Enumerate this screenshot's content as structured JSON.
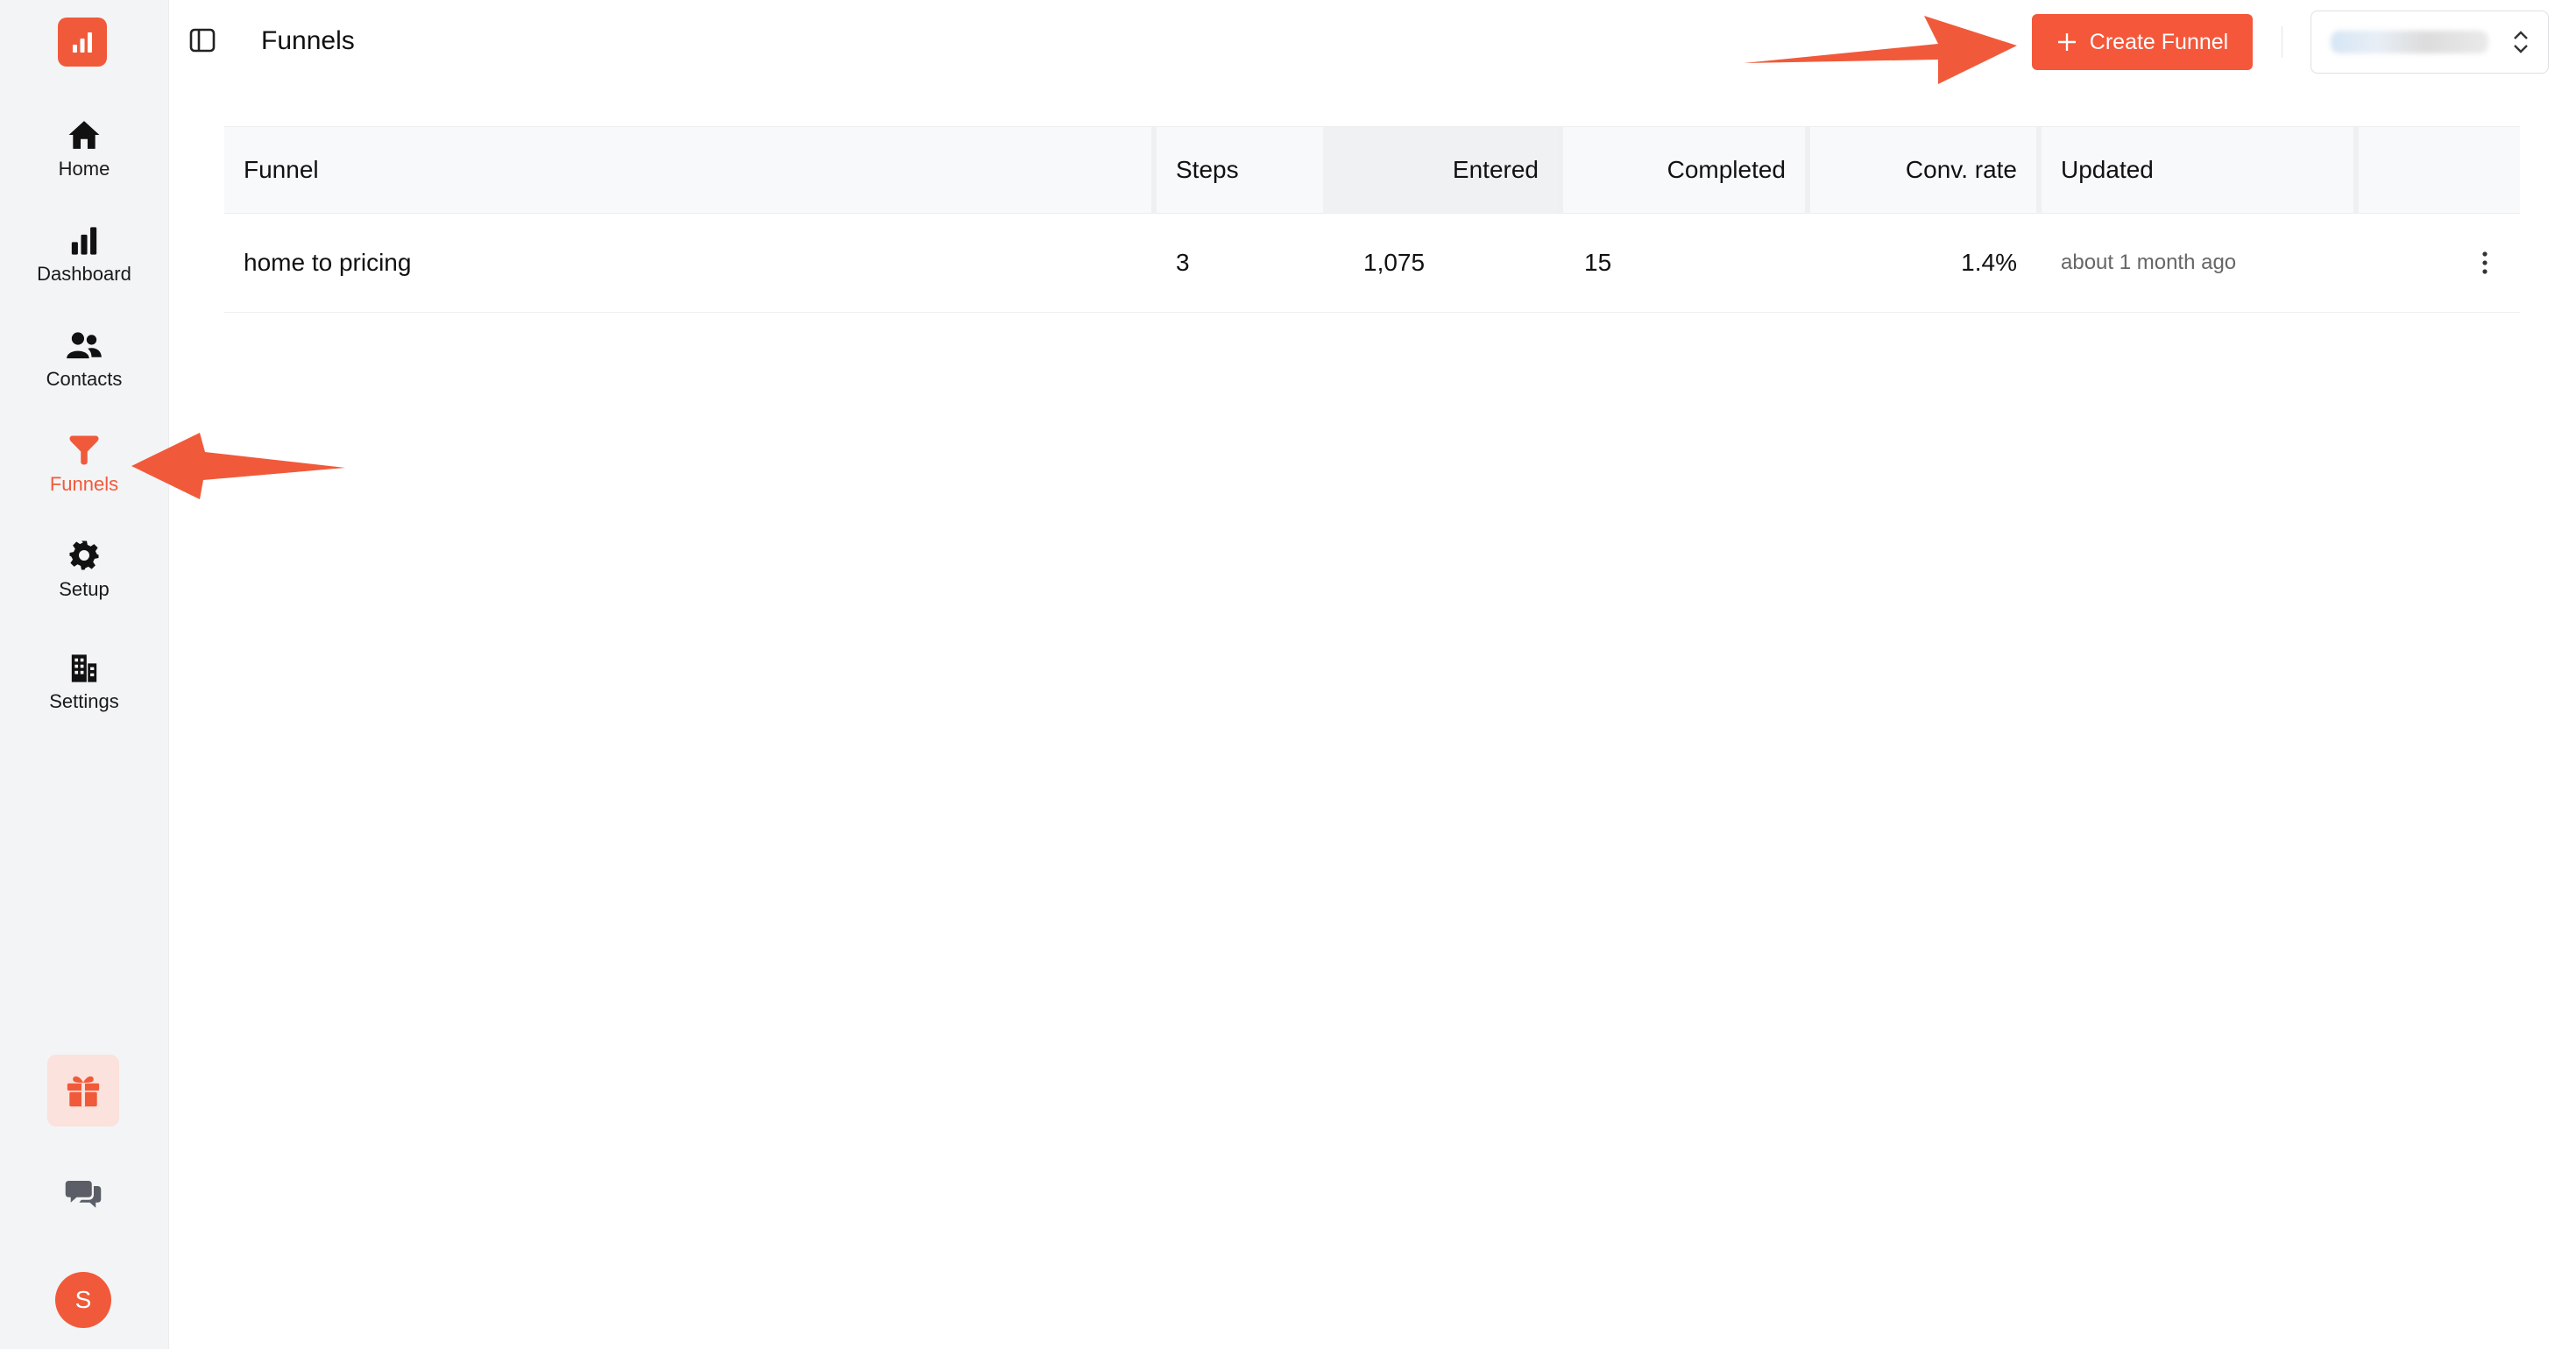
{
  "sidebar": {
    "items": [
      {
        "label": "Home",
        "icon": "home-icon"
      },
      {
        "label": "Dashboard",
        "icon": "bar-chart-icon"
      },
      {
        "label": "Contacts",
        "icon": "users-icon"
      },
      {
        "label": "Funnels",
        "icon": "funnel-icon"
      },
      {
        "label": "Setup",
        "icon": "gear-icon"
      },
      {
        "label": "Settings",
        "icon": "building-icon"
      }
    ],
    "active": "Funnels",
    "avatar_initial": "S"
  },
  "header": {
    "title": "Funnels",
    "create_button_label": "Create Funnel"
  },
  "table": {
    "columns": [
      "Funnel",
      "Steps",
      "Entered",
      "Completed",
      "Conv. rate",
      "Updated"
    ],
    "rows": [
      {
        "funnel": "home to pricing",
        "steps": "3",
        "entered": "1,075",
        "completed": "15",
        "conv_rate": "1.4%",
        "updated": "about 1 month ago"
      }
    ]
  },
  "colors": {
    "accent": "#f5573a",
    "sidebar_bg": "#f3f4f6",
    "annotation_arrow": "#f05a3a"
  }
}
